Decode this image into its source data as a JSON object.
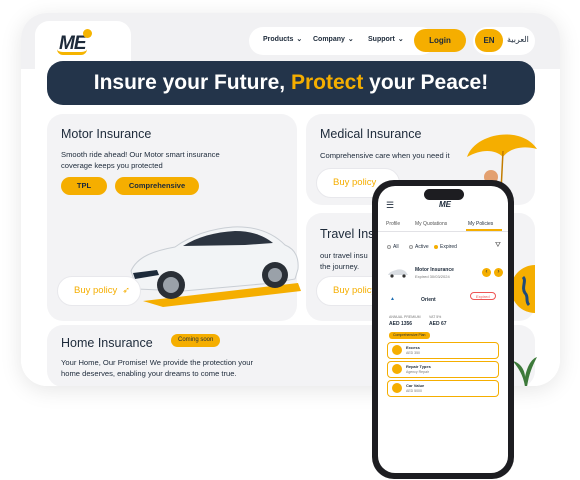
{
  "header": {
    "logo_text": "ME",
    "nav": [
      {
        "label": "Products"
      },
      {
        "label": "Company"
      },
      {
        "label": "Support"
      }
    ],
    "login_label": "Login",
    "lang_en": "EN",
    "lang_ar": "العربية"
  },
  "hero": {
    "part1": "Insure your Future,",
    "highlight": "Protect",
    "part2": "your Peace!"
  },
  "motor": {
    "title": "Motor Insurance",
    "text": "Smooth ride ahead! Our Motor smart insurance coverage keeps you protected",
    "tag_tpl": "TPL",
    "tag_comprehensive": "Comprehensive",
    "buy_label": "Buy policy"
  },
  "medical": {
    "title": "Medical Insurance",
    "text": "Comprehensive care when you need it",
    "buy_label": "Buy policy"
  },
  "travel": {
    "title": "Travel Ins",
    "text_line1": "our travel insu",
    "text_line2": "the journey.",
    "buy_label": "Buy policy"
  },
  "home": {
    "title": "Home Insurance",
    "badge": "Coming soon",
    "text": "Your Home, Our Promise! We provide the protection your home deserves, enabling your dreams to come true."
  },
  "phone": {
    "logo": "ME",
    "tabs": [
      "Profile",
      "My Quotations",
      "My Policies"
    ],
    "filters": {
      "all": "All",
      "active": "Active",
      "expired": "Expired"
    },
    "policy_title": "Motor Insurance",
    "policy_sub": "Expired 30/03/2024",
    "insurer": "Orient",
    "status": "Expired",
    "amount1_label": "ANNUAL PREMIUM",
    "amount1": "AED 1356",
    "amount2_label": "VAT 5%",
    "amount2": "AED 67",
    "section": "Comprehensive Plan",
    "addons": [
      {
        "name": "Excess",
        "value": "AED 350"
      },
      {
        "name": "Repair Types",
        "value": "Agency Repair"
      },
      {
        "name": "Car Value",
        "value": "AED 5000"
      }
    ]
  },
  "colors": {
    "accent": "#f5ae00",
    "navy": "#23344a",
    "card_bg": "#f3f3f5"
  }
}
